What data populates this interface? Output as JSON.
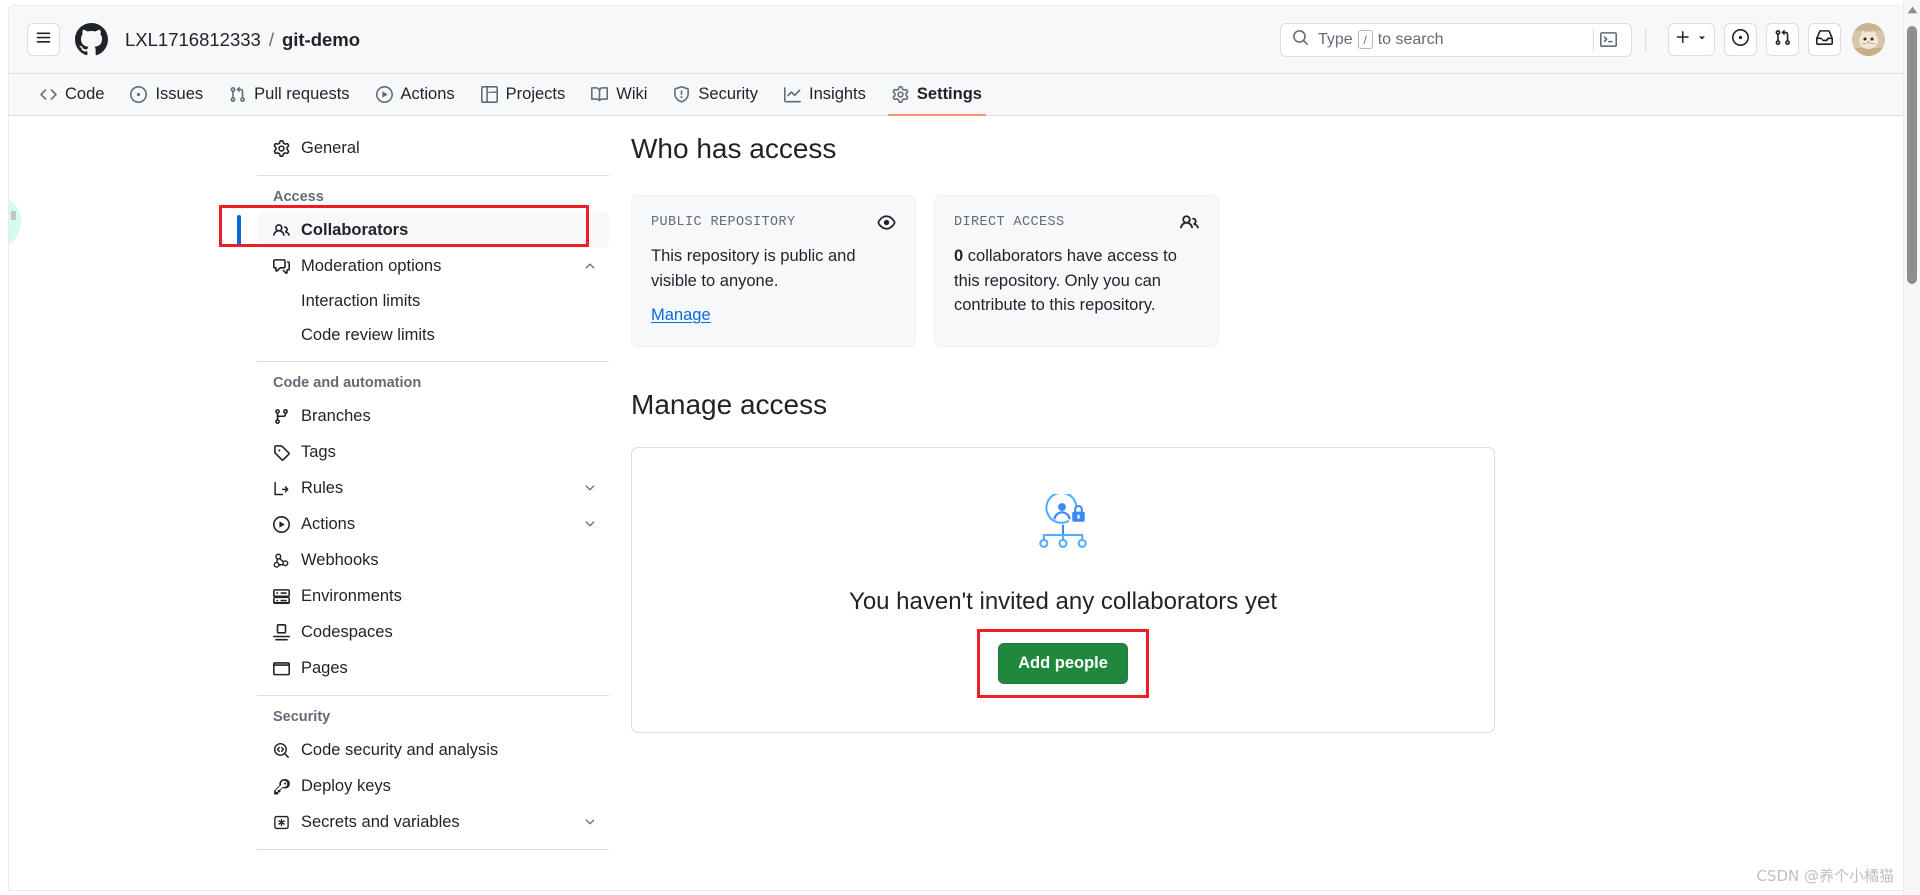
{
  "header": {
    "hamburger_icon": "hamburger-menu-icon",
    "logo_icon": "github-logo-icon",
    "owner": "LXL1716812333",
    "separator": "/",
    "repo": "git-demo",
    "search": {
      "placeholder_prefix": "Type",
      "key_hint": "/",
      "placeholder_suffix": "to search",
      "search_icon": "search-icon",
      "command_palette_icon": "command-palette-icon"
    },
    "actions": [
      {
        "name": "create-new-button",
        "icon": "plus-icon",
        "has_caret": true,
        "caret": "▾"
      },
      {
        "name": "issues-button",
        "icon": "issue-opened-icon"
      },
      {
        "name": "pull-requests-button",
        "icon": "git-pull-request-icon"
      },
      {
        "name": "notifications-inbox-button",
        "icon": "inbox-icon"
      }
    ],
    "avatar": {
      "name": "user-avatar",
      "alt": "user profile picture"
    }
  },
  "repo_nav": {
    "tabs": [
      {
        "label": "Code",
        "icon": "code-icon",
        "active": false
      },
      {
        "label": "Issues",
        "icon": "issue-opened-icon",
        "active": false
      },
      {
        "label": "Pull requests",
        "icon": "git-pull-request-icon",
        "active": false
      },
      {
        "label": "Actions",
        "icon": "play-icon",
        "active": false
      },
      {
        "label": "Projects",
        "icon": "table-icon",
        "active": false
      },
      {
        "label": "Wiki",
        "icon": "book-icon",
        "active": false
      },
      {
        "label": "Security",
        "icon": "shield-icon",
        "active": false
      },
      {
        "label": "Insights",
        "icon": "graph-icon",
        "active": false
      },
      {
        "label": "Settings",
        "icon": "gear-icon",
        "active": true
      }
    ],
    "active_underline_color": "#fd8c73"
  },
  "sidebar": {
    "general": {
      "label": "General",
      "icon": "gear-icon"
    },
    "groups": [
      {
        "title": "Access",
        "items": [
          {
            "label": "Collaborators",
            "icon": "people-icon",
            "selected": true,
            "chevron": null,
            "annotated": true
          },
          {
            "label": "Moderation options",
            "icon": "comment-discussion-icon",
            "selected": false,
            "chevron": "up"
          }
        ],
        "subitems": [
          {
            "label": "Interaction limits"
          },
          {
            "label": "Code review limits"
          }
        ]
      },
      {
        "title": "Code and automation",
        "items": [
          {
            "label": "Branches",
            "icon": "git-branch-icon",
            "chevron": null
          },
          {
            "label": "Tags",
            "icon": "tag-icon",
            "chevron": null
          },
          {
            "label": "Rules",
            "icon": "rules-icon",
            "chevron": "down"
          },
          {
            "label": "Actions",
            "icon": "play-icon",
            "chevron": "down"
          },
          {
            "label": "Webhooks",
            "icon": "webhook-icon",
            "chevron": null
          },
          {
            "label": "Environments",
            "icon": "server-icon",
            "chevron": null
          },
          {
            "label": "Codespaces",
            "icon": "codespaces-icon",
            "chevron": null
          },
          {
            "label": "Pages",
            "icon": "browser-icon",
            "chevron": null
          }
        ]
      },
      {
        "title": "Security",
        "items": [
          {
            "label": "Code security and analysis",
            "icon": "codescan-icon",
            "chevron": null
          },
          {
            "label": "Deploy keys",
            "icon": "key-icon",
            "chevron": null
          },
          {
            "label": "Secrets and variables",
            "icon": "asterisk-key-icon",
            "chevron": "down"
          }
        ]
      }
    ]
  },
  "main": {
    "who_has_access_title": "Who has access",
    "cards": [
      {
        "label": "PUBLIC REPOSITORY",
        "icon": "eye-icon",
        "body": "This repository is public and visible to anyone.",
        "link": "Manage"
      },
      {
        "label": "DIRECT ACCESS",
        "icon": "people-icon",
        "count": "0",
        "body_after_count": " collaborators have access to this repository. Only you can contribute to this repository."
      }
    ],
    "manage_access_title": "Manage access",
    "empty_state": {
      "illustration": "person-lock-org-chart-illustration",
      "title": "You haven't invited any collaborators yet",
      "button_label": "Add people",
      "button_color": "#1f883d",
      "annotated": true
    }
  },
  "annotations": {
    "ring_color": "#ee1e26"
  },
  "scrollbar": {
    "up_arrow_icon": "scroll-up-arrow-icon",
    "thumb_name": "scrollbar-thumb"
  },
  "watermark": "CSDN @养个小橘猫"
}
